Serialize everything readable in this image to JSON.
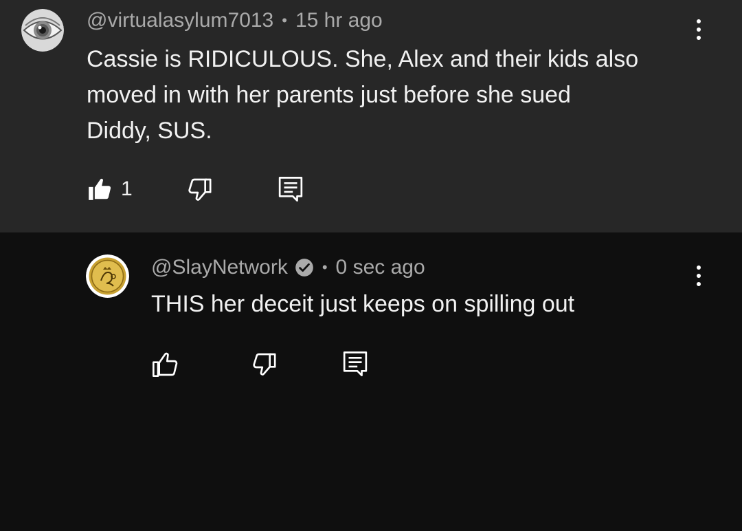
{
  "comments": [
    {
      "author": "@virtualasylum7013",
      "separator": "•",
      "time": "15 hr ago",
      "text": "Cassie is RIDICULOUS. She, Alex and their kids also\nmoved in with her parents just before she sued\nDiddy, SUS.",
      "like_count": "1",
      "liked": true,
      "avatar_icon": "eye-photo-avatar"
    },
    {
      "author": "@SlayNetwork",
      "verified": true,
      "separator": "•",
      "time": "0 sec ago",
      "text": "THIS her deceit just keeps on spilling out",
      "like_count": "",
      "liked": false,
      "avatar_icon": "gold-coin-logo-avatar"
    }
  ],
  "colors": {
    "top_background": "#272727",
    "reply_background": "#0f0f0f",
    "meta_text": "#aaaaaa",
    "body_text": "#f1f1f1"
  },
  "icons": [
    "thumbs-up-icon",
    "thumbs-down-icon",
    "reply-icon",
    "more-options-icon",
    "verified-check-icon"
  ]
}
